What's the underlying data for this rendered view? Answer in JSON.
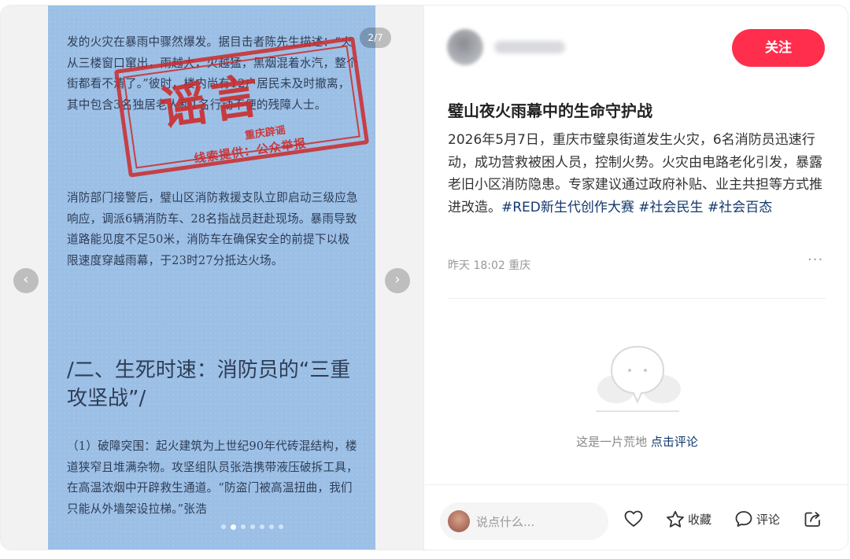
{
  "gallery": {
    "page_indicator": "2/7",
    "current_index": 2,
    "total": 7,
    "image": {
      "paragraph1": "发的火灾在暴雨中骤然爆发。据目击者陈先生描述：“火从三楼窗口窜出，雨越大，火越猛，黑烟混着水汽，整个街都看不清了。”彼时，楼内尚有12户居民未及时撤离，其中包含3名独居老人和1名行动不便的残障人士。",
      "paragraph2": "消防部门接警后，璧山区消防救援支队立即启动三级应急响应，调派6辆消防车、28名指战员赶赴现场。暴雨导致道路能见度不足50米，消防车在确保安全的前提下以极限速度穿越雨幕，于23时27分抵达火场。",
      "heading": "/二、生死时速：消防员的“三重攻坚战”/",
      "paragraph3": "（1）破障突围：起火建筑为上世纪90年代砖混结构，楼道狭窄且堆满杂物。攻坚组队员张浩携带液压破拆工具，在高温浓烟中开辟救生通道。“防盗门被高温扭曲，我们只能从外墙架设拉梯。”张浩",
      "stamp": {
        "main": "谣言",
        "line1": "重庆辟谣",
        "line2": "线索提供：公众举报"
      }
    }
  },
  "author": {
    "follow_label": "关注"
  },
  "post": {
    "title": "璧山夜火雨幕中的生命守护战",
    "body": "2026年5月7日，重庆市璧泉街道发生火灾，6名消防员迅速行动，成功营救被困人员，控制火势。火灾由电路老化引发，暴露老旧小区消防隐患。专家建议通过政府补贴、业主共担等方式推进改造。",
    "tags": [
      "#RED新生代创作大赛",
      "#社会民生",
      "#社会百态"
    ],
    "meta": "昨天 18:02 重庆",
    "more": "···"
  },
  "comments": {
    "empty_text": "这是一片荒地",
    "empty_link": "点击评论"
  },
  "bottom_bar": {
    "input_placeholder": "说点什么...",
    "collect_label": "收藏",
    "comment_label": "评论"
  },
  "colors": {
    "accent": "#ff2e4d",
    "tag": "#13386c",
    "stamp": "#cc2b2b",
    "image_bg": "#9cbfe6"
  }
}
